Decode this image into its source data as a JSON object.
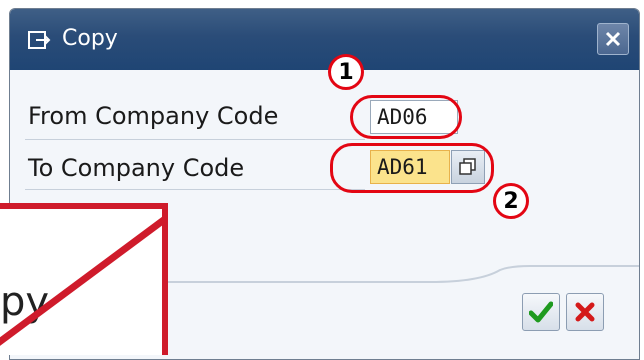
{
  "dialog": {
    "title": "Copy",
    "title_icon": "copy-arrow-icon",
    "close_icon": "close-icon"
  },
  "fields": {
    "from_label": "From Company Code",
    "from_value": "AD06",
    "to_label": "To Company Code",
    "to_value": "AD61",
    "value_help_icon": "copy-box-icon"
  },
  "annotations": {
    "badge_1": "1",
    "badge_2": "2",
    "callout_color": "#e30613"
  },
  "buttons": {
    "ok_icon": "checkmark-icon",
    "cancel_icon": "red-x-icon"
  },
  "overlay": {
    "partial_text": "py",
    "accent_color": "#cf1b2b"
  },
  "colors": {
    "titlebar": "#2a4c78",
    "highlight_field": "#fbe38c"
  }
}
